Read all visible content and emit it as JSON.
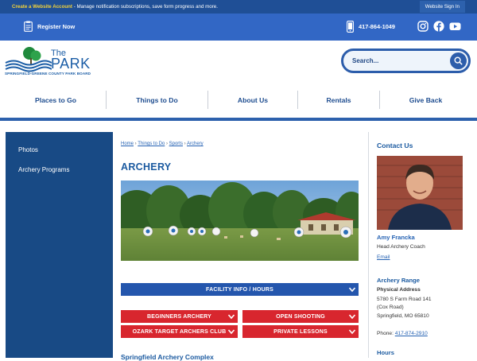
{
  "top_strip": {
    "create_account": "Create a Website Account",
    "message": " - Manage notification subscriptions, save form progress and more.",
    "sign_in": "Website Sign In"
  },
  "header": {
    "register": "Register Now",
    "phone": "417-864-1049",
    "social": [
      "instagram-icon",
      "facebook-icon",
      "youtube-icon"
    ]
  },
  "logo": {
    "the": "The",
    "park": "PARK",
    "subtitle": "SPRINGFIELD-GREENE COUNTY PARK BOARD"
  },
  "search": {
    "placeholder": "Search..."
  },
  "nav": [
    "Places to Go",
    "Things to Do",
    "About Us",
    "Rentals",
    "Give Back"
  ],
  "sidebar": [
    "Photos",
    "Archery Programs"
  ],
  "breadcrumb": [
    "Home",
    "Things to Do",
    "Sports",
    "Archery"
  ],
  "page_title": "ARCHERY",
  "buttons": {
    "facility": "FACILITY INFO / HOURS",
    "beginners": "BEGINNERS ARCHERY",
    "open_shooting": "OPEN SHOOTING",
    "ozark": "OZARK TARGET ARCHERS CLUB",
    "private": "PRIVATE LESSONS"
  },
  "section_heading": "Springfield Archery Complex",
  "contact": {
    "heading": "Contact Us",
    "name": "Amy Francka",
    "role": "Head Archery Coach",
    "email": "Email",
    "location_heading": "Archery Range",
    "address_label": "Physical Address",
    "address_line1": "5780 S Farm Road 141",
    "address_line2": "(Cox Road)",
    "address_line3": "Springfield, MO 65810",
    "phone_label": "Phone: ",
    "phone": "417-874-2910",
    "hours_heading": "Hours"
  },
  "colors": {
    "primary": "#3267c5",
    "dark_blue": "#184a85",
    "accent_red": "#d8262e",
    "highlight_yellow": "#f2d23a"
  }
}
